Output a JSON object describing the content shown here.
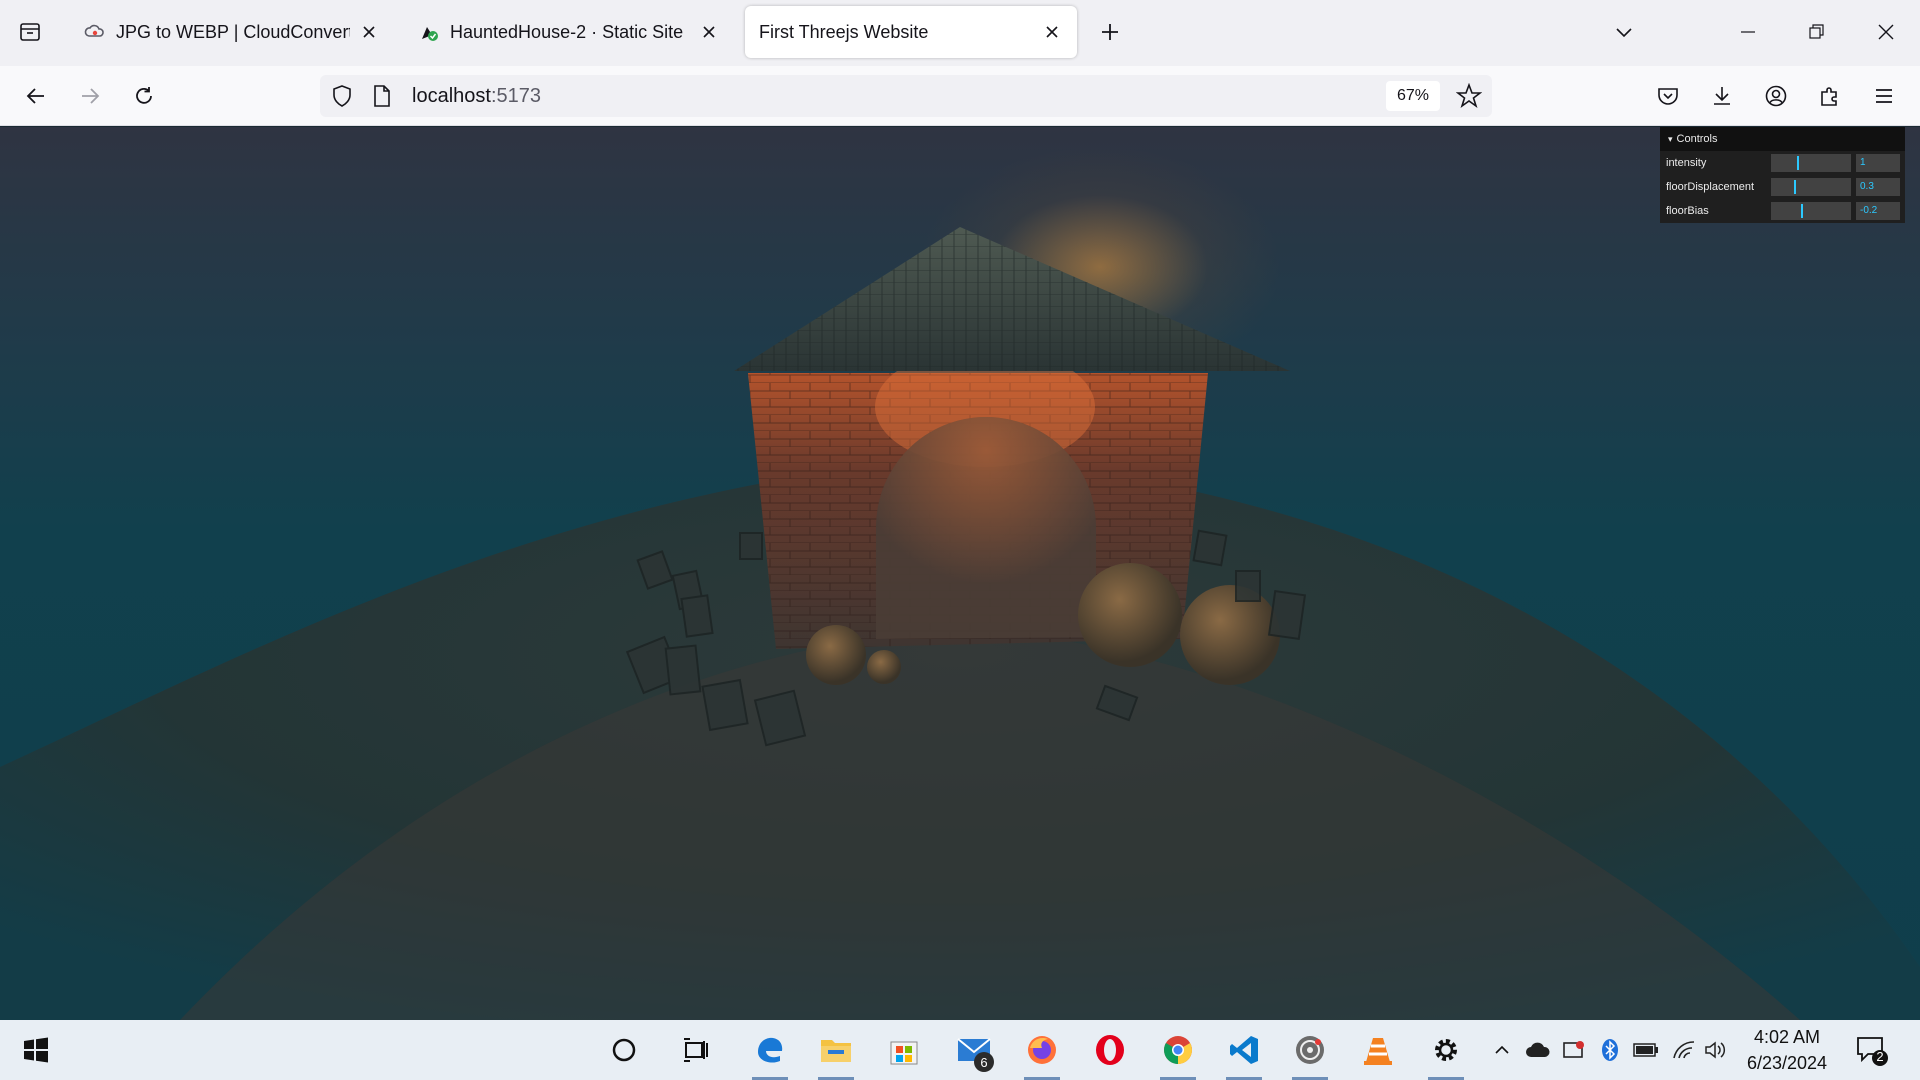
{
  "browser": {
    "tabs": [
      {
        "title": "JPG to WEBP | CloudConvert",
        "active": false
      },
      {
        "title": "HauntedHouse-2 · Static Site",
        "active": false
      },
      {
        "title": "First Threejs Website",
        "active": true
      }
    ],
    "url_host": "localhost",
    "url_port": ":5173",
    "zoom": "67%"
  },
  "gui": {
    "title": "Controls",
    "controls": [
      {
        "label": "intensity",
        "value": "1",
        "fraction": 0.33
      },
      {
        "label": "floorDisplacement",
        "value": "0.3",
        "fraction": 0.29
      },
      {
        "label": "floorBias",
        "value": "-0.2",
        "fraction": 0.38
      }
    ]
  },
  "taskbar": {
    "mail_badge": "6",
    "time": "4:02 AM",
    "date": "6/23/2024",
    "notification_count": "2"
  },
  "colors": {
    "accent": "#2cc9ff",
    "browser_bg": "#f0f0f4",
    "taskbar_bg": "#e8eef4"
  }
}
